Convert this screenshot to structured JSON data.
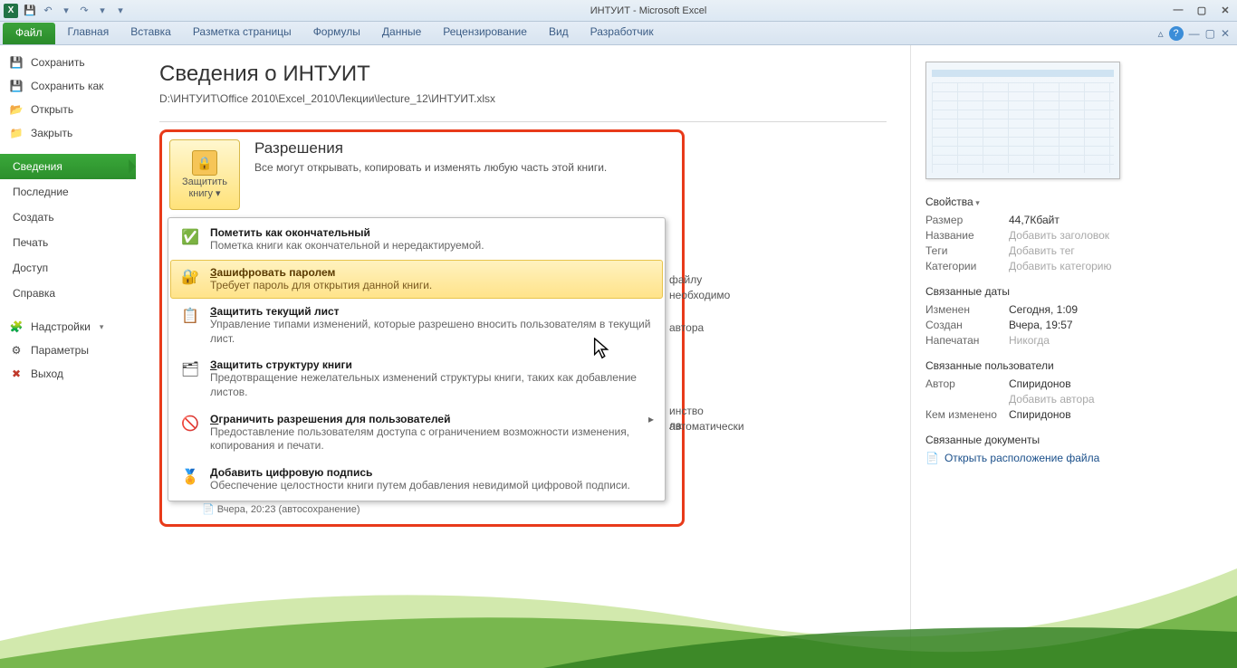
{
  "window": {
    "title": "ИНТУИТ  -  Microsoft Excel"
  },
  "ribbon": {
    "file": "Файл",
    "tabs": [
      "Главная",
      "Вставка",
      "Разметка страницы",
      "Формулы",
      "Данные",
      "Рецензирование",
      "Вид",
      "Разработчик"
    ]
  },
  "leftnav": {
    "save": "Сохранить",
    "saveas": "Сохранить как",
    "open": "Открыть",
    "close": "Закрыть",
    "info": "Сведения",
    "recent": "Последние",
    "new": "Создать",
    "print": "Печать",
    "share": "Доступ",
    "help": "Справка",
    "addins": "Надстройки",
    "options": "Параметры",
    "exit": "Выход"
  },
  "main": {
    "title": "Сведения о ИНТУИТ",
    "path": "D:\\ИНТУИТ\\Office 2010\\Excel_2010\\Лекции\\lecture_12\\ИНТУИТ.xlsx",
    "perm_title": "Разрешения",
    "perm_desc": "Все могут открывать, копировать и изменять любую часть этой книги.",
    "protect_btn_l1": "Защитить",
    "protect_btn_l2": "книгу ▾",
    "peek1": "файлу необходимо",
    "peek2": "автора",
    "peek3": "инство автоматически",
    "peek4": "ла.",
    "bottom": "Вчера, 20:23 (автосохранение)"
  },
  "menu": {
    "m1t": "Пометить как окончательный",
    "m1d": "Пометка книги как окончательной и нередактируемой.",
    "m2t": "Зашифровать паролем",
    "m2d": "Требует пароль для открытия данной книги.",
    "m3t": "Защитить текущий лист",
    "m3d": "Управление типами изменений, которые разрешено вносить пользователям в текущий лист.",
    "m4t": "Защитить структуру книги",
    "m4d": "Предотвращение нежелательных изменений структуры книги, таких как добавление листов.",
    "m5t": "Ограничить разрешения для пользователей",
    "m5d": "Предоставление пользователям доступа с ограничением возможности изменения, копирования и печати.",
    "m6t": "Добавить цифровую подпись",
    "m6d": "Обеспечение целостности книги путем добавления невидимой цифровой подписи."
  },
  "props": {
    "sect_props": "Свойства",
    "size_k": "Размер",
    "size_v": "44,7Кбайт",
    "title_k": "Название",
    "title_v": "Добавить заголовок",
    "tags_k": "Теги",
    "tags_v": "Добавить тег",
    "cat_k": "Категории",
    "cat_v": "Добавить категорию",
    "sect_dates": "Связанные даты",
    "mod_k": "Изменен",
    "mod_v": "Сегодня, 1:09",
    "crt_k": "Создан",
    "crt_v": "Вчера, 19:57",
    "prn_k": "Напечатан",
    "prn_v": "Никогда",
    "sect_people": "Связанные пользователи",
    "auth_k": "Автор",
    "auth_v": "Спиридонов",
    "addauth": "Добавить автора",
    "modby_k": "Кем изменено",
    "modby_v": "Спиридонов",
    "sect_docs": "Связанные документы",
    "openloc": "Открыть расположение файла"
  }
}
